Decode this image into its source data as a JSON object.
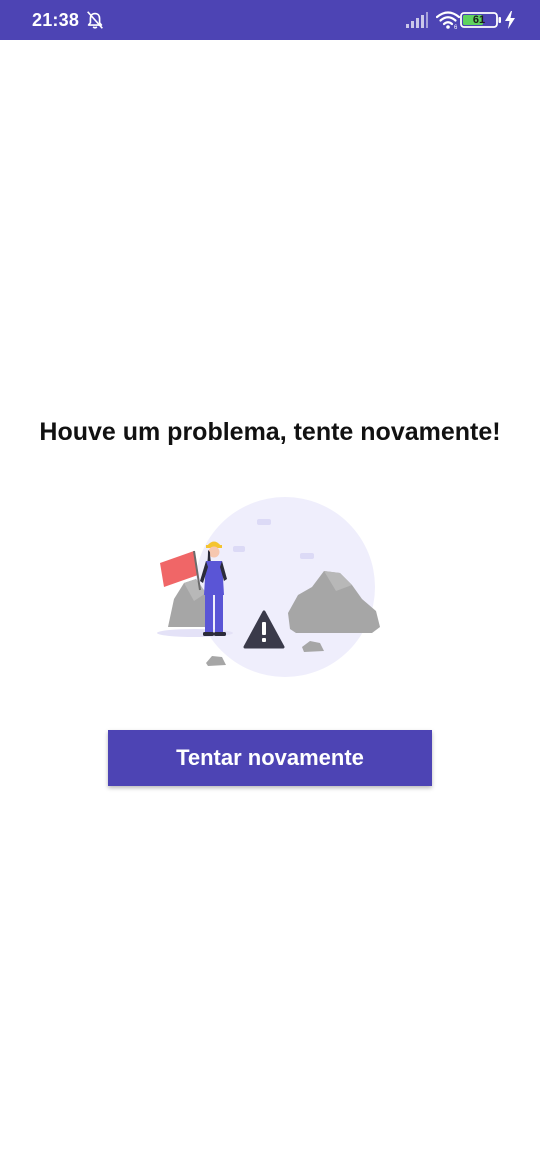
{
  "status_bar": {
    "time": "21:38",
    "battery_level": "61",
    "icons": [
      "alarm-off-icon",
      "signal-icon",
      "wifi-icon",
      "battery-icon",
      "charging-bolt-icon"
    ]
  },
  "error": {
    "title": "Houve um problema, tente novamente!"
  },
  "actions": {
    "retry_label": "Tentar novamente"
  },
  "colors": {
    "accent": "#4d44b4",
    "flag": "#f06667",
    "rock": "#a6a6a6",
    "circle": "#efeefc",
    "warning": "#3a3a4a"
  }
}
